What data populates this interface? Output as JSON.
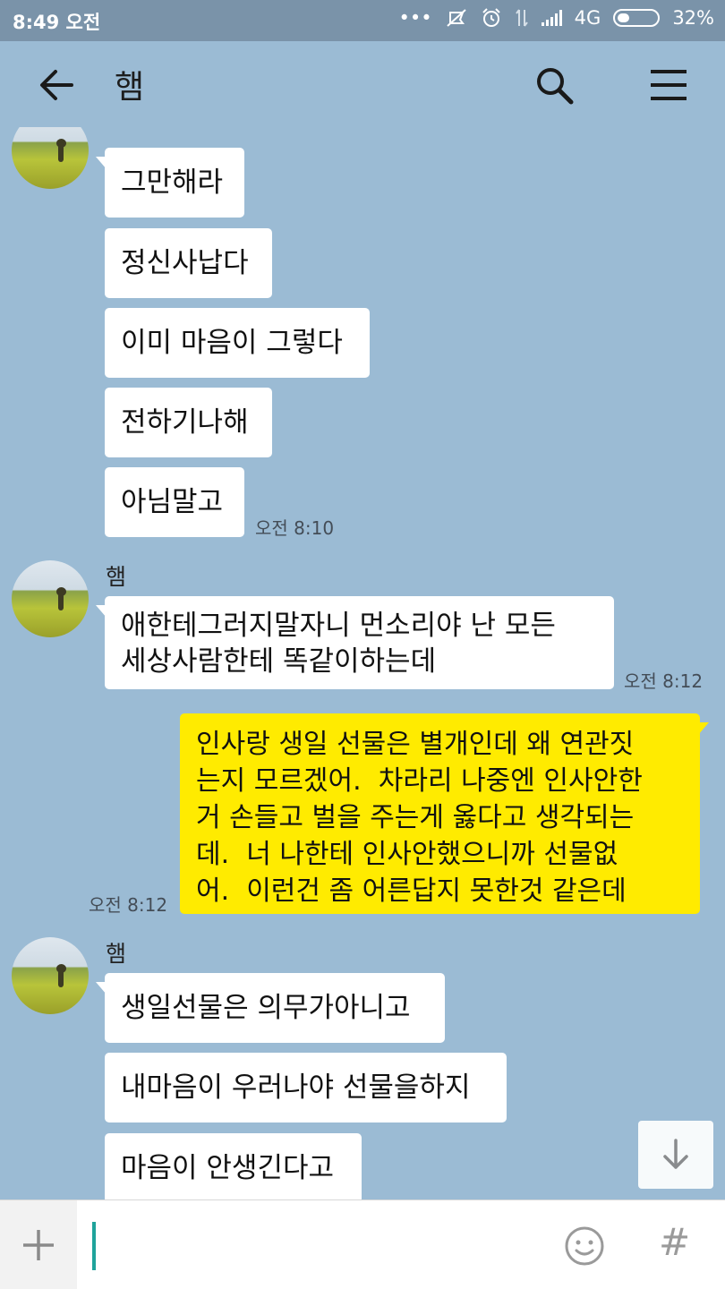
{
  "status_bar": {
    "time": "8:49 오전",
    "dots": "•••",
    "network": "4G",
    "battery": "32%",
    "battery_level": 0.32
  },
  "header": {
    "title": "햄",
    "back_icon": "arrow-left-icon",
    "search_icon": "search-icon",
    "menu_icon": "hamburger-menu-icon"
  },
  "messages": [
    {
      "sender": "",
      "text": "그만해라"
    },
    {
      "sender": "",
      "text": "정신사납다"
    },
    {
      "sender": "",
      "text": "이미 마음이 그렇다"
    },
    {
      "sender": "",
      "text": "전하기나해"
    },
    {
      "sender": "",
      "text": "아님말고",
      "time": "오전 8:10"
    },
    {
      "sender": "햄",
      "text": "애한테그러지말자니 먼소리야 난 모든\n세상사람한테 똑같이하는데",
      "time": "오전 8:12"
    },
    {
      "sender": "me",
      "text": "인사랑 생일 선물은 별개인데 왜 연관짓\n는지 모르겠어.  차라리 나중엔 인사안한\n거 손들고 벌을 주는게 옳다고 생각되는\n데.  너 나한테 인사안했으니까 선물없\n어.  이런건 좀 어른답지 못한것 같은데",
      "time": "오전 8:12"
    },
    {
      "sender": "햄",
      "text": "생일선물은 의무가아니고"
    },
    {
      "sender": "",
      "text": "내마음이 우러나야 선물을하지"
    },
    {
      "sender": "",
      "text": "마음이 안생긴다고"
    }
  ],
  "scroll_down_icon": "arrow-down-icon",
  "input_bar": {
    "plus_icon": "plus-icon",
    "value": "",
    "emoji_icon": "emoticon-icon",
    "hash_label": "#"
  },
  "colors": {
    "background": "#9bbbd4",
    "my_bubble": "#ffeb00",
    "their_bubble": "#ffffff",
    "caret": "#1fa39b"
  }
}
